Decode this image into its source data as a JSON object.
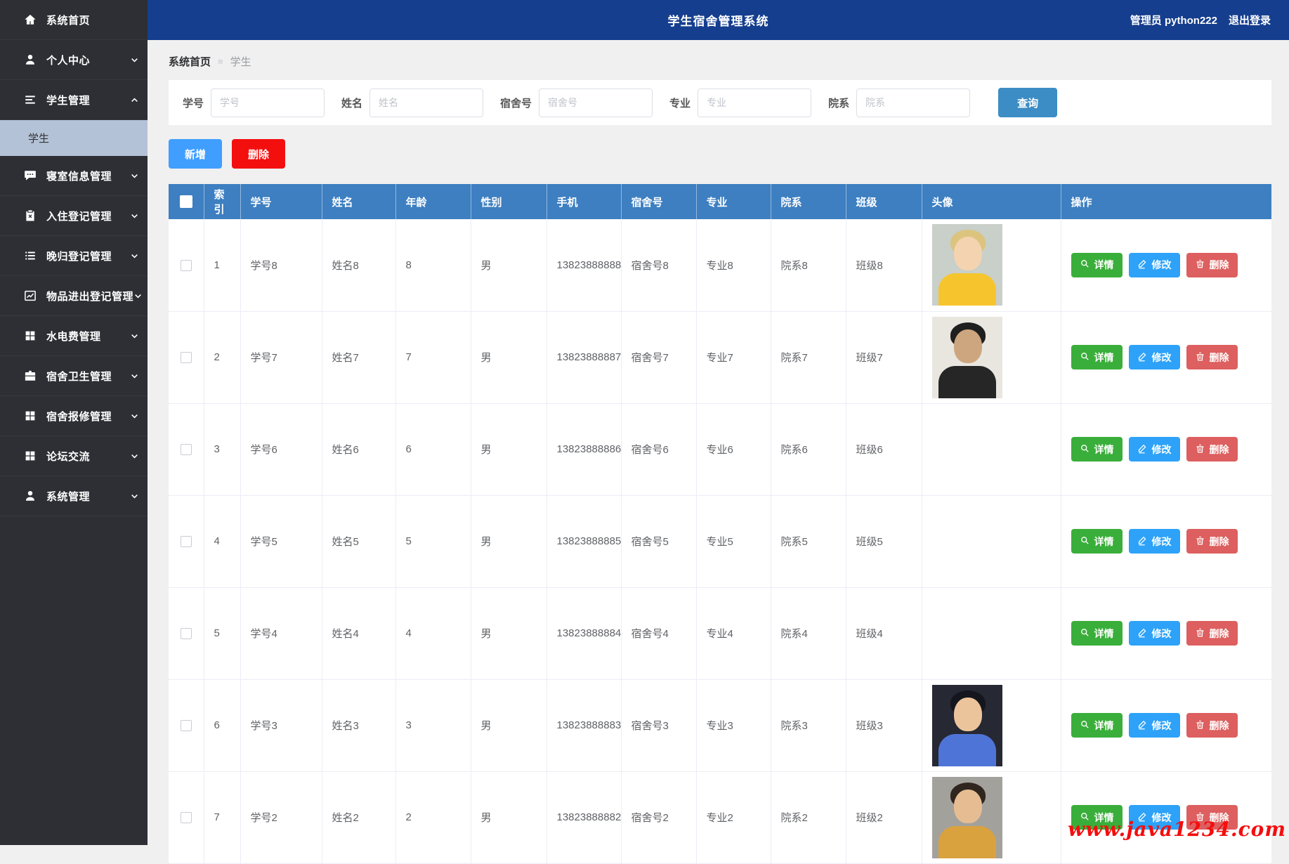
{
  "app": {
    "title": "学生宿舍管理系统",
    "user": "管理员 python222",
    "logout": "退出登录"
  },
  "sidebar": {
    "items": [
      {
        "label": "系统首页",
        "icon": "home",
        "chevron": null
      },
      {
        "label": "个人中心",
        "icon": "user",
        "chevron": "down"
      },
      {
        "label": "学生管理",
        "icon": "menu",
        "chevron": "up",
        "expanded": true,
        "children": [
          {
            "label": "学生",
            "active": true
          }
        ]
      },
      {
        "label": "寝室信息管理",
        "icon": "chat",
        "chevron": "down"
      },
      {
        "label": "入住登记管理",
        "icon": "clipboard",
        "chevron": "down"
      },
      {
        "label": "晚归登记管理",
        "icon": "list",
        "chevron": "down"
      },
      {
        "label": "物品进出登记管理",
        "icon": "chart",
        "chevron": "down"
      },
      {
        "label": "水电费管理",
        "icon": "grid",
        "chevron": "down"
      },
      {
        "label": "宿舍卫生管理",
        "icon": "briefcase",
        "chevron": "down"
      },
      {
        "label": "宿舍报修管理",
        "icon": "grid",
        "chevron": "down"
      },
      {
        "label": "论坛交流",
        "icon": "grid",
        "chevron": "down"
      },
      {
        "label": "系统管理",
        "icon": "user",
        "chevron": "down"
      }
    ]
  },
  "breadcrumb": [
    "系统首页",
    "学生"
  ],
  "filters": [
    {
      "label": "学号",
      "placeholder": "学号",
      "value": ""
    },
    {
      "label": "姓名",
      "placeholder": "姓名",
      "value": ""
    },
    {
      "label": "宿舍号",
      "placeholder": "宿舍号",
      "value": ""
    },
    {
      "label": "专业",
      "placeholder": "专业",
      "value": ""
    },
    {
      "label": "院系",
      "placeholder": "院系",
      "value": ""
    }
  ],
  "search_button": "查询",
  "toolbar": {
    "add": "新增",
    "delete": "删除"
  },
  "table": {
    "columns": [
      {
        "key": "checkbox",
        "label": "",
        "cls": "col-check"
      },
      {
        "key": "index",
        "label": "索引",
        "cls": "col-index"
      },
      {
        "key": "student_no",
        "label": "学号",
        "cls": "col-sno"
      },
      {
        "key": "name",
        "label": "姓名",
        "cls": "col-name"
      },
      {
        "key": "age",
        "label": "年龄",
        "cls": "col-age"
      },
      {
        "key": "gender",
        "label": "性别",
        "cls": "col-gender"
      },
      {
        "key": "phone",
        "label": "手机",
        "cls": "col-phone"
      },
      {
        "key": "dorm_no",
        "label": "宿舍号",
        "cls": "col-dorm"
      },
      {
        "key": "major",
        "label": "专业",
        "cls": "col-major"
      },
      {
        "key": "department",
        "label": "院系",
        "cls": "col-dept"
      },
      {
        "key": "class_name",
        "label": "班级",
        "cls": "col-class"
      },
      {
        "key": "avatar",
        "label": "头像",
        "cls": "col-avatar"
      },
      {
        "key": "actions",
        "label": "操作",
        "cls": "col-ops"
      }
    ],
    "rows": [
      {
        "index": "1",
        "student_no": "学号8",
        "name": "姓名8",
        "age": "8",
        "gender": "男",
        "phone": "13823888888",
        "dorm_no": "宿舍号8",
        "major": "专业8",
        "department": "院系8",
        "class_name": "班级8",
        "avatar": {
          "bg": "#c9cfc9",
          "hair": "#dcc47e",
          "skin": "#f3d3b0",
          "shirt": "#f6c52e"
        }
      },
      {
        "index": "2",
        "student_no": "学号7",
        "name": "姓名7",
        "age": "7",
        "gender": "男",
        "phone": "13823888887",
        "dorm_no": "宿舍号7",
        "major": "专业7",
        "department": "院系7",
        "class_name": "班级7",
        "avatar": {
          "bg": "#e9e6e0",
          "hair": "#1f1f1f",
          "skin": "#cda67f",
          "shirt": "#262626"
        }
      },
      {
        "index": "3",
        "student_no": "学号6",
        "name": "姓名6",
        "age": "6",
        "gender": "男",
        "phone": "13823888886",
        "dorm_no": "宿舍号6",
        "major": "专业6",
        "department": "院系6",
        "class_name": "班级6",
        "avatar": null
      },
      {
        "index": "4",
        "student_no": "学号5",
        "name": "姓名5",
        "age": "5",
        "gender": "男",
        "phone": "13823888885",
        "dorm_no": "宿舍号5",
        "major": "专业5",
        "department": "院系5",
        "class_name": "班级5",
        "avatar": null
      },
      {
        "index": "5",
        "student_no": "学号4",
        "name": "姓名4",
        "age": "4",
        "gender": "男",
        "phone": "13823888884",
        "dorm_no": "宿舍号4",
        "major": "专业4",
        "department": "院系4",
        "class_name": "班级4",
        "avatar": null
      },
      {
        "index": "6",
        "student_no": "学号3",
        "name": "姓名3",
        "age": "3",
        "gender": "男",
        "phone": "13823888883",
        "dorm_no": "宿舍号3",
        "major": "专业3",
        "department": "院系3",
        "class_name": "班级3",
        "avatar": {
          "bg": "#262833",
          "hair": "#15161d",
          "skin": "#ecc49c",
          "shirt": "#4f74d8"
        }
      },
      {
        "index": "7",
        "student_no": "学号2",
        "name": "姓名2",
        "age": "2",
        "gender": "男",
        "phone": "13823888882",
        "dorm_no": "宿舍号2",
        "major": "专业2",
        "department": "院系2",
        "class_name": "班级2",
        "avatar": {
          "bg": "#a3a19c",
          "hair": "#30261f",
          "skin": "#e6bd92",
          "shirt": "#d9a23f"
        }
      }
    ]
  },
  "row_actions": [
    "详情",
    "修改",
    "删除"
  ],
  "watermark": "www.java1234.com",
  "colors": {
    "header_bg": "#153e8e",
    "sidebar_bg": "#2d2f34",
    "sidebar_active_bg": "#b4c2d8",
    "table_header_bg": "#3d7fc1",
    "search_btn": "#3c8dc5",
    "add_btn": "#409eff",
    "delete_btn": "#f40f0f",
    "detail_btn": "#3aae3a",
    "edit_btn": "#2da2f8",
    "row_delete_btn": "#dd5f5f",
    "watermark_color": "#f50d0d"
  }
}
